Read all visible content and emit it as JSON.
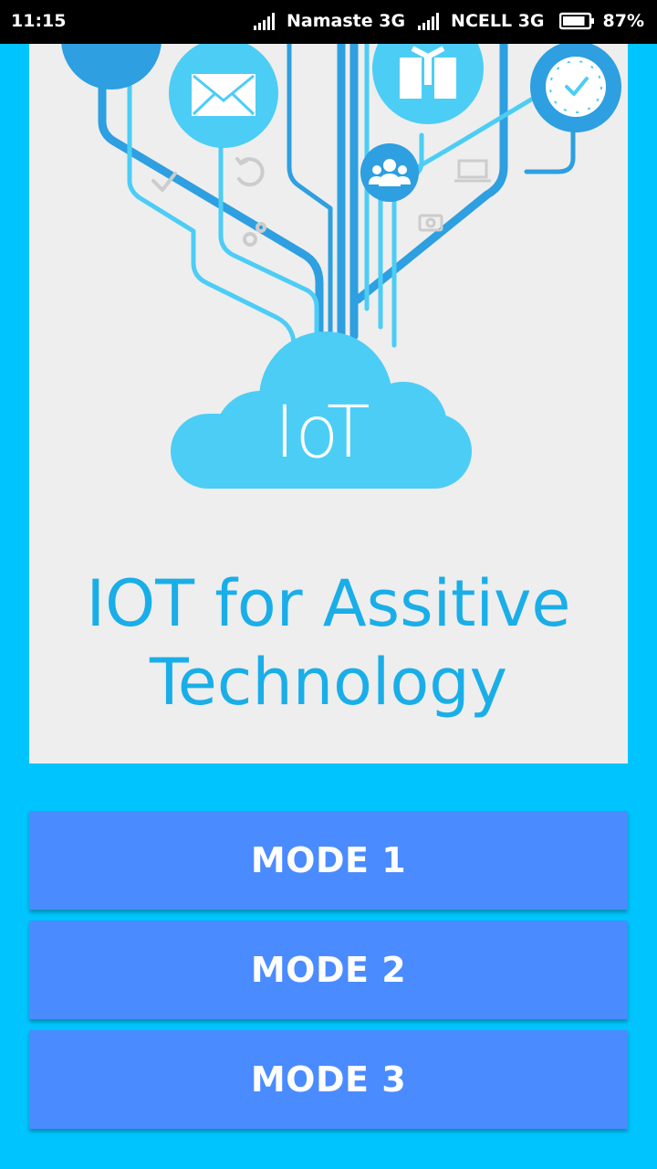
{
  "status_bar": {
    "time": "11:15",
    "carrier1": "Namaste 3G",
    "carrier2": "NCELL 3G",
    "battery_percent": "87%",
    "battery_level": 0.87
  },
  "illustration": {
    "cloud_label": "IoT"
  },
  "title": {
    "line1": "IOT for Assitive",
    "line2": "Technology"
  },
  "buttons": {
    "mode1": "MODE 1",
    "mode2": "MODE 2",
    "mode3": "MODE 3"
  },
  "colors": {
    "background": "#00c4fd",
    "card": "#eeeeee",
    "title": "#1aaee8",
    "button": "#4a8bff",
    "illustration_dark": "#2e9fe0",
    "illustration_light": "#4ccdf5"
  },
  "icons": [
    "envelope-icon",
    "gift-icon",
    "clock-icon",
    "group-icon",
    "check-icon",
    "refresh-icon",
    "laptop-icon",
    "camera-icon",
    "battery-icon",
    "signal-icon"
  ]
}
